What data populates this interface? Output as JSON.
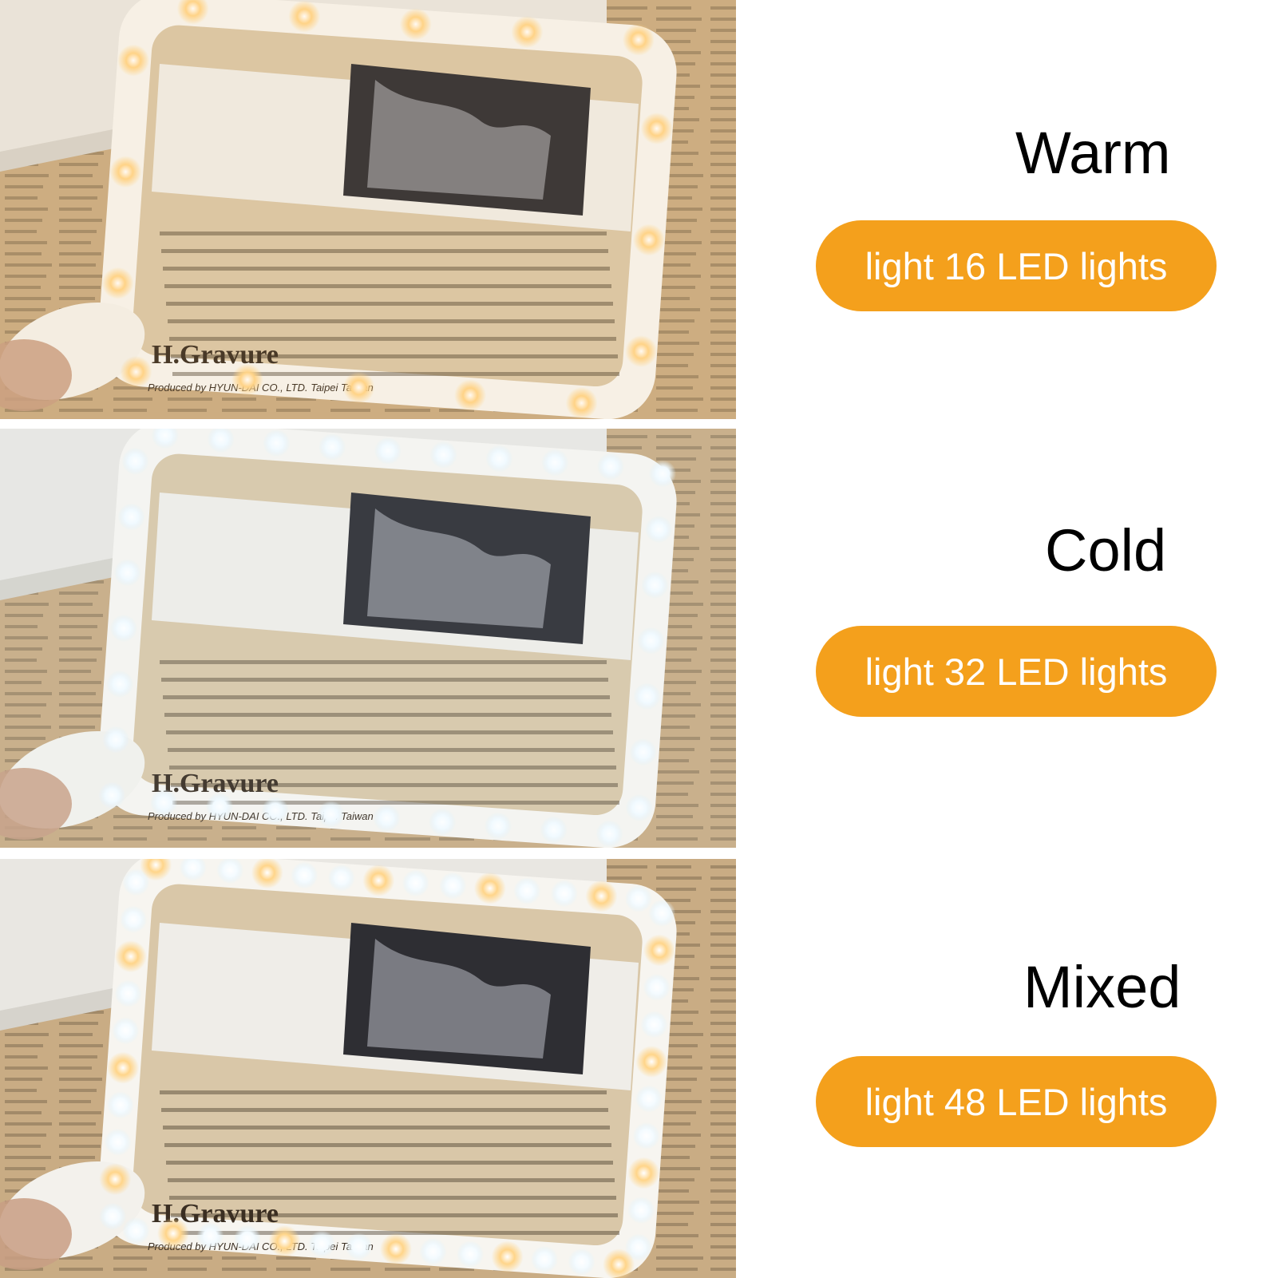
{
  "colors": {
    "accent": "#F4A01C",
    "background": "#FFFFFF",
    "title_text": "#000000",
    "label_text": "#FFFFFF",
    "warm_led": "#FFD58A",
    "cold_led": "#F4FBFF",
    "newspaper": "#C9AC84"
  },
  "modes": [
    {
      "title": "Warm",
      "label": "light 16 LED lights",
      "led_count": 16,
      "led_style": "warm"
    },
    {
      "title": "Cold",
      "label": "light 32 LED lights",
      "led_count": 32,
      "led_style": "cold"
    },
    {
      "title": "Mixed",
      "label": "light 48 LED lights",
      "led_count": 48,
      "led_style": "mixed"
    }
  ],
  "photo_text": {
    "caption_large": "H.Gravure",
    "caption_small": "Produced by HYUN-DAI CO., LTD. Taipei Taiwan"
  }
}
